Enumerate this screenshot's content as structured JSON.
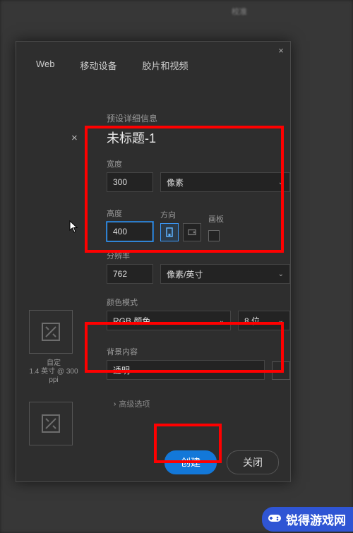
{
  "background": {
    "panel_title": "校准"
  },
  "dialog": {
    "tabs": [
      "Web",
      "移动设备",
      "胶片和视频"
    ],
    "preset_info_label": "预设详细信息",
    "doc_title": "未标题-1",
    "width": {
      "label": "宽度",
      "value": "300",
      "unit_select": "像素"
    },
    "height": {
      "label": "高度",
      "value": "400"
    },
    "orientation_label": "方向",
    "artboard_label": "画板",
    "resolution": {
      "label": "分辨率",
      "value": "762",
      "unit": "像素/英寸"
    },
    "color_mode": {
      "label": "颜色模式",
      "mode": "RGB 颜色",
      "depth": "8 位"
    },
    "background": {
      "label": "背景内容",
      "value": "透明"
    },
    "advanced_label": "高级选项",
    "preset_caption": {
      "line1": "自定",
      "line2": "1.4 英寸 @ 300 ppi"
    },
    "buttons": {
      "create": "创建",
      "close": "关闭"
    }
  },
  "watermark": "锐得游戏网"
}
